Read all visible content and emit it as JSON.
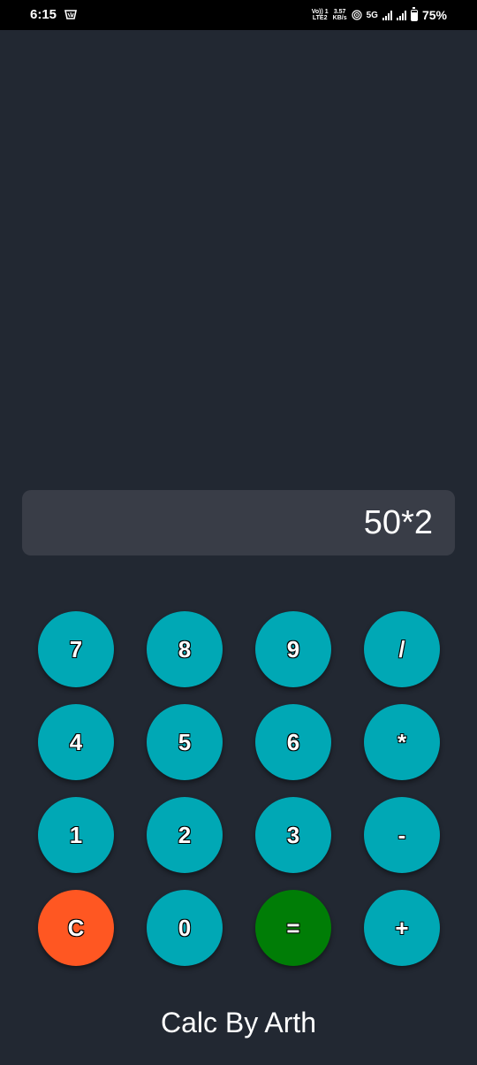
{
  "status_bar": {
    "time": "6:15",
    "volte_top": "Vo)) 1",
    "volte_bottom": "LTE2",
    "speed_value": "3.57",
    "speed_unit": "KB/s",
    "network": "5G",
    "battery": "75%",
    "battery_level": 0.75
  },
  "display": {
    "value": "50*2"
  },
  "keypad": {
    "keys": [
      "7",
      "8",
      "9",
      "/",
      "4",
      "5",
      "6",
      "*",
      "1",
      "2",
      "3",
      "-",
      "C",
      "0",
      "=",
      "+"
    ]
  },
  "footer": {
    "title": "Calc By Arth"
  },
  "colors": {
    "background": "#222832",
    "display_background": "#393d47",
    "key": "#00a8b5",
    "clear_key": "#ff5722",
    "equals_key": "#007d06"
  },
  "icons": [
    "notification-icon",
    "hotspot-icon",
    "signal-icon",
    "battery-icon"
  ]
}
